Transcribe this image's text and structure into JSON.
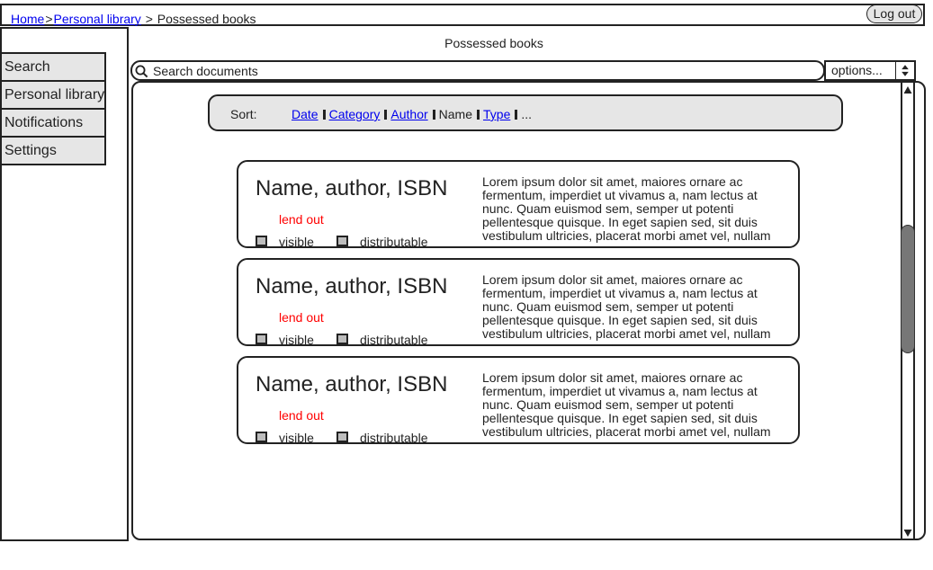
{
  "breadcrumb": {
    "home": "Home",
    "personal_library": "Personal library",
    "separator": ">",
    "current": "Possessed books"
  },
  "header": {
    "logout_label": "Log out"
  },
  "sidebar": {
    "items": [
      {
        "label": "Search"
      },
      {
        "label": "Personal library"
      },
      {
        "label": "Notifications"
      },
      {
        "label": "Settings"
      }
    ]
  },
  "page": {
    "title": "Possessed books"
  },
  "search": {
    "placeholder": "Search documents",
    "icon": "search-icon"
  },
  "options": {
    "label": "options..."
  },
  "sort": {
    "label": "Sort:",
    "options": [
      "Date",
      "Category",
      "Author",
      "Name",
      "Type"
    ],
    "ellipsis": "..."
  },
  "books": [
    {
      "title": "Name, author, ISBN",
      "status": "lend out",
      "visible_label": "visible",
      "distributable_label": "distributable",
      "description": "Lorem ipsum dolor sit amet, maiores ornare ac fermentum, imperdiet ut vivamus a, nam lectus at nunc. Quam euismod sem, semper ut potenti pellentesque quisque. In eget sapien sed, sit duis vestibulum ultricies, placerat morbi amet vel, nullam"
    },
    {
      "title": "Name, author, ISBN",
      "status": "lend out",
      "visible_label": "visible",
      "distributable_label": "distributable",
      "description": "Lorem ipsum dolor sit amet, maiores ornare ac fermentum, imperdiet ut vivamus a, nam lectus at nunc. Quam euismod sem, semper ut potenti pellentesque quisque. In eget sapien sed, sit duis vestibulum ultricies, placerat morbi amet vel, nullam"
    },
    {
      "title": "Name, author, ISBN",
      "status": "lend out",
      "visible_label": "visible",
      "distributable_label": "distributable",
      "description": "Lorem ipsum dolor sit amet, maiores ornare ac fermentum, imperdiet ut vivamus a, nam lectus at nunc. Quam euismod sem, semper ut potenti pellentesque quisque. In eget sapien sed, sit duis vestibulum ultricies, placerat morbi amet vel, nullam"
    }
  ],
  "colors": {
    "link": "#0000ee",
    "status": "#ff0000",
    "panel_fill": "#e6e6e6",
    "scroll_thumb": "#777777"
  }
}
